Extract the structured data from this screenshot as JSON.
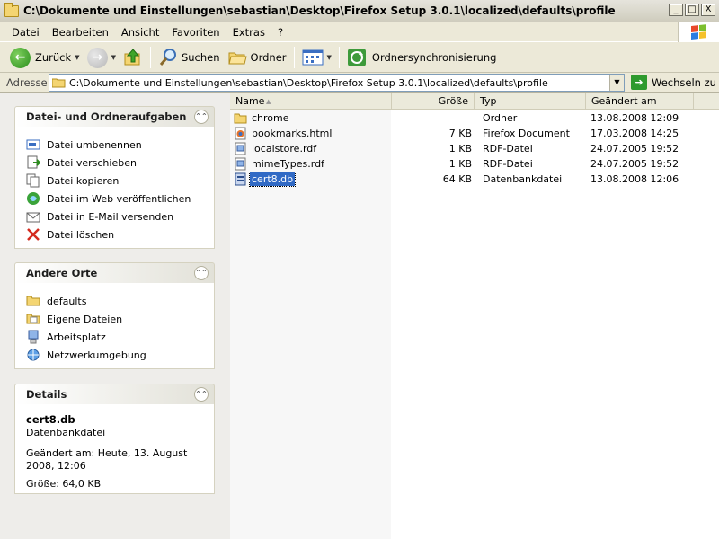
{
  "window": {
    "title": "C:\\Dokumente und Einstellungen\\sebastian\\Desktop\\Firefox Setup 3.0.1\\localized\\defaults\\profile",
    "minimize_label": "_",
    "maximize_label": "□",
    "close_label": "X"
  },
  "menu": {
    "items": [
      "Datei",
      "Bearbeiten",
      "Ansicht",
      "Favoriten",
      "Extras",
      "?"
    ]
  },
  "toolbar": {
    "back_label": "Zurück",
    "search_label": "Suchen",
    "folders_label": "Ordner",
    "sync_label": "Ordnersynchronisierung"
  },
  "address": {
    "label": "Adresse",
    "value": "C:\\Dokumente und Einstellungen\\sebastian\\Desktop\\Firefox Setup 3.0.1\\localized\\defaults\\profile",
    "go_label": "Wechseln zu"
  },
  "tasks_panel": {
    "title": "Datei- und Ordneraufgaben",
    "items": [
      {
        "label": "Datei umbenennen",
        "icon": "rename-icon"
      },
      {
        "label": "Datei verschieben",
        "icon": "move-icon"
      },
      {
        "label": "Datei kopieren",
        "icon": "copy-icon"
      },
      {
        "label": "Datei im Web veröffentlichen",
        "icon": "publish-icon"
      },
      {
        "label": "Datei in E-Mail versenden",
        "icon": "email-icon"
      },
      {
        "label": "Datei löschen",
        "icon": "delete-icon"
      }
    ]
  },
  "places_panel": {
    "title": "Andere Orte",
    "items": [
      {
        "label": "defaults",
        "icon": "folder-icon"
      },
      {
        "label": "Eigene Dateien",
        "icon": "my-documents-icon"
      },
      {
        "label": "Arbeitsplatz",
        "icon": "my-computer-icon"
      },
      {
        "label": "Netzwerkumgebung",
        "icon": "network-icon"
      }
    ]
  },
  "details_panel": {
    "title": "Details",
    "file_name": "cert8.db",
    "file_type": "Datenbankdatei",
    "modified": "Geändert am: Heute, 13. August 2008, 12:06",
    "size": "Größe: 64,0 KB"
  },
  "filelist": {
    "columns": {
      "name": "Name",
      "size": "Größe",
      "type": "Typ",
      "date": "Geändert am"
    },
    "rows": [
      {
        "name": "chrome",
        "size": "",
        "type": "Ordner",
        "date": "13.08.2008 12:09",
        "icon": "folder-icon",
        "selected": false
      },
      {
        "name": "bookmarks.html",
        "size": "7 KB",
        "type": "Firefox Document",
        "date": "17.03.2008 14:25",
        "icon": "firefox-document-icon",
        "selected": false
      },
      {
        "name": "localstore.rdf",
        "size": "1 KB",
        "type": "RDF-Datei",
        "date": "24.07.2005 19:52",
        "icon": "rdf-file-icon",
        "selected": false
      },
      {
        "name": "mimeTypes.rdf",
        "size": "1 KB",
        "type": "RDF-Datei",
        "date": "24.07.2005 19:52",
        "icon": "rdf-file-icon",
        "selected": false
      },
      {
        "name": "cert8.db",
        "size": "64 KB",
        "type": "Datenbankdatei",
        "date": "13.08.2008 12:06",
        "icon": "database-file-icon",
        "selected": true
      }
    ]
  },
  "colors": {
    "selection": "#316ac5",
    "sort_column": "#f7f7f7",
    "chrome": "#ece9d8"
  }
}
